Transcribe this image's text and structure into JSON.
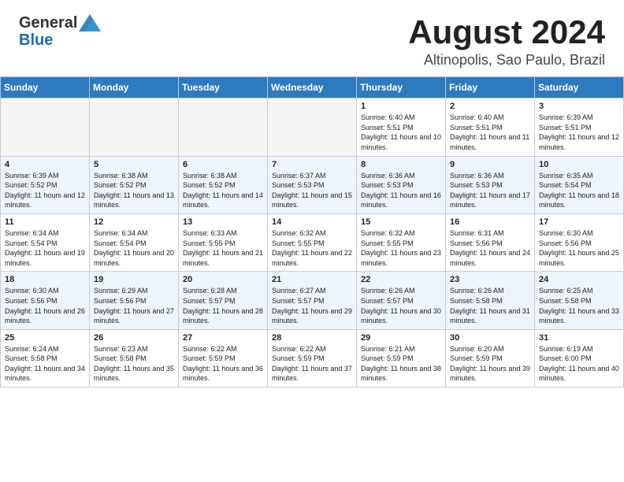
{
  "header": {
    "logo_general": "General",
    "logo_blue": "Blue",
    "month_year": "August 2024",
    "location": "Altinopolis, Sao Paulo, Brazil"
  },
  "days_of_week": [
    "Sunday",
    "Monday",
    "Tuesday",
    "Wednesday",
    "Thursday",
    "Friday",
    "Saturday"
  ],
  "weeks": [
    [
      {
        "day": "",
        "empty": true
      },
      {
        "day": "",
        "empty": true
      },
      {
        "day": "",
        "empty": true
      },
      {
        "day": "",
        "empty": true
      },
      {
        "day": "1",
        "sunrise": "6:40 AM",
        "sunset": "5:51 PM",
        "daylight": "11 hours and 10 minutes."
      },
      {
        "day": "2",
        "sunrise": "6:40 AM",
        "sunset": "5:51 PM",
        "daylight": "11 hours and 11 minutes."
      },
      {
        "day": "3",
        "sunrise": "6:39 AM",
        "sunset": "5:51 PM",
        "daylight": "11 hours and 12 minutes."
      }
    ],
    [
      {
        "day": "4",
        "sunrise": "6:39 AM",
        "sunset": "5:52 PM",
        "daylight": "11 hours and 12 minutes."
      },
      {
        "day": "5",
        "sunrise": "6:38 AM",
        "sunset": "5:52 PM",
        "daylight": "11 hours and 13 minutes."
      },
      {
        "day": "6",
        "sunrise": "6:38 AM",
        "sunset": "5:52 PM",
        "daylight": "11 hours and 14 minutes."
      },
      {
        "day": "7",
        "sunrise": "6:37 AM",
        "sunset": "5:53 PM",
        "daylight": "11 hours and 15 minutes."
      },
      {
        "day": "8",
        "sunrise": "6:36 AM",
        "sunset": "5:53 PM",
        "daylight": "11 hours and 16 minutes."
      },
      {
        "day": "9",
        "sunrise": "6:36 AM",
        "sunset": "5:53 PM",
        "daylight": "11 hours and 17 minutes."
      },
      {
        "day": "10",
        "sunrise": "6:35 AM",
        "sunset": "5:54 PM",
        "daylight": "11 hours and 18 minutes."
      }
    ],
    [
      {
        "day": "11",
        "sunrise": "6:34 AM",
        "sunset": "5:54 PM",
        "daylight": "11 hours and 19 minutes."
      },
      {
        "day": "12",
        "sunrise": "6:34 AM",
        "sunset": "5:54 PM",
        "daylight": "11 hours and 20 minutes."
      },
      {
        "day": "13",
        "sunrise": "6:33 AM",
        "sunset": "5:55 PM",
        "daylight": "11 hours and 21 minutes."
      },
      {
        "day": "14",
        "sunrise": "6:32 AM",
        "sunset": "5:55 PM",
        "daylight": "11 hours and 22 minutes."
      },
      {
        "day": "15",
        "sunrise": "6:32 AM",
        "sunset": "5:55 PM",
        "daylight": "11 hours and 23 minutes."
      },
      {
        "day": "16",
        "sunrise": "6:31 AM",
        "sunset": "5:56 PM",
        "daylight": "11 hours and 24 minutes."
      },
      {
        "day": "17",
        "sunrise": "6:30 AM",
        "sunset": "5:56 PM",
        "daylight": "11 hours and 25 minutes."
      }
    ],
    [
      {
        "day": "18",
        "sunrise": "6:30 AM",
        "sunset": "5:56 PM",
        "daylight": "11 hours and 26 minutes."
      },
      {
        "day": "19",
        "sunrise": "6:29 AM",
        "sunset": "5:56 PM",
        "daylight": "11 hours and 27 minutes."
      },
      {
        "day": "20",
        "sunrise": "6:28 AM",
        "sunset": "5:57 PM",
        "daylight": "11 hours and 28 minutes."
      },
      {
        "day": "21",
        "sunrise": "6:27 AM",
        "sunset": "5:57 PM",
        "daylight": "11 hours and 29 minutes."
      },
      {
        "day": "22",
        "sunrise": "6:26 AM",
        "sunset": "5:57 PM",
        "daylight": "11 hours and 30 minutes."
      },
      {
        "day": "23",
        "sunrise": "6:26 AM",
        "sunset": "5:58 PM",
        "daylight": "11 hours and 31 minutes."
      },
      {
        "day": "24",
        "sunrise": "6:25 AM",
        "sunset": "5:58 PM",
        "daylight": "11 hours and 33 minutes."
      }
    ],
    [
      {
        "day": "25",
        "sunrise": "6:24 AM",
        "sunset": "5:58 PM",
        "daylight": "11 hours and 34 minutes."
      },
      {
        "day": "26",
        "sunrise": "6:23 AM",
        "sunset": "5:58 PM",
        "daylight": "11 hours and 35 minutes."
      },
      {
        "day": "27",
        "sunrise": "6:22 AM",
        "sunset": "5:59 PM",
        "daylight": "11 hours and 36 minutes."
      },
      {
        "day": "28",
        "sunrise": "6:22 AM",
        "sunset": "5:59 PM",
        "daylight": "11 hours and 37 minutes."
      },
      {
        "day": "29",
        "sunrise": "6:21 AM",
        "sunset": "5:59 PM",
        "daylight": "11 hours and 38 minutes."
      },
      {
        "day": "30",
        "sunrise": "6:20 AM",
        "sunset": "5:59 PM",
        "daylight": "11 hours and 39 minutes."
      },
      {
        "day": "31",
        "sunrise": "6:19 AM",
        "sunset": "6:00 PM",
        "daylight": "11 hours and 40 minutes."
      }
    ]
  ],
  "labels": {
    "sunrise": "Sunrise:",
    "sunset": "Sunset:",
    "daylight": "Daylight:"
  }
}
